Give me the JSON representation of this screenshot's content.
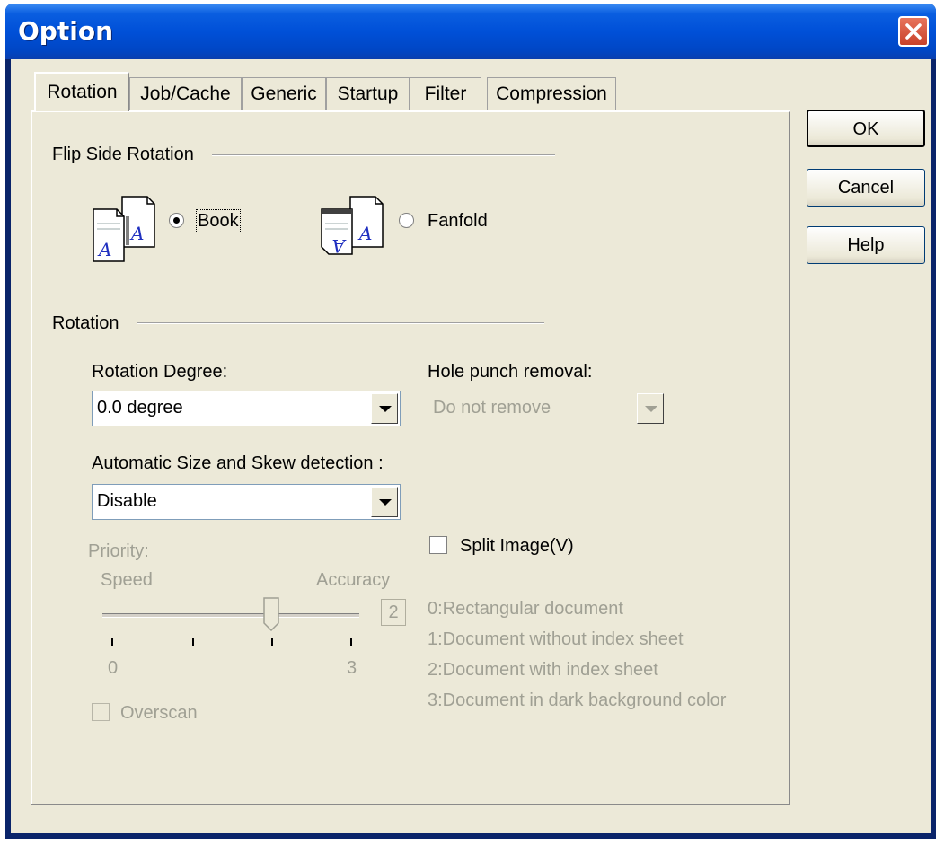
{
  "window": {
    "title": "Option"
  },
  "tabs": [
    "Rotation",
    "Job/Cache",
    "Generic",
    "Startup",
    "Filter",
    "Compression"
  ],
  "buttons": {
    "ok": "OK",
    "cancel": "Cancel",
    "help": "Help"
  },
  "flip_side": {
    "heading": "Flip Side Rotation",
    "book_label": "Book",
    "fanfold_label": "Fanfold",
    "selected": "Book"
  },
  "rotation": {
    "heading": "Rotation",
    "degree_label": "Rotation Degree:",
    "degree_value": "0.0 degree",
    "hole_punch_label": "Hole punch removal:",
    "hole_punch_value": "Do not remove",
    "auto_detect_label": "Automatic Size and Skew detection :",
    "auto_detect_value": "Disable"
  },
  "priority": {
    "label": "Priority:",
    "speed_label": "Speed",
    "accuracy_label": "Accuracy",
    "value": "2",
    "min_label": "0",
    "max_label": "3",
    "slider_value": 2,
    "slider_max": 3
  },
  "split_image": {
    "label": "Split Image(V)",
    "checked": false
  },
  "overscan": {
    "label": "Overscan",
    "checked": false
  },
  "doc_types": [
    "0:Rectangular document",
    "1:Document without index sheet",
    "2:Document with index sheet",
    "3:Document in dark background color"
  ],
  "icons": {
    "close": "close-icon",
    "book": "book-pages-icon",
    "fanfold": "fanfold-pages-icon"
  }
}
